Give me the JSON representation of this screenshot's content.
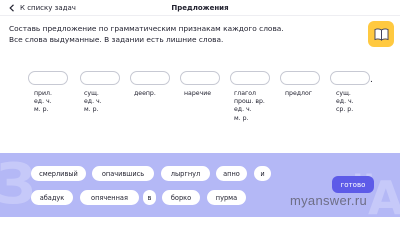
{
  "header": {
    "back_label": "К списку задач",
    "title": "Предложения"
  },
  "instructions": {
    "line1": "Составь предложение по грамматическим признакам каждого слова.",
    "line2": "Все слова выдуманные. В задании есть лишние слова."
  },
  "sentence": {
    "period": ".",
    "hints": [
      [
        "прил.",
        "ед. ч.",
        "м. р."
      ],
      [
        "сущ.",
        "ед. ч.",
        "м. р."
      ],
      [
        "деепр."
      ],
      [
        "наречие"
      ],
      [
        "глагол",
        "прош. вр.",
        "ед. ч.",
        "м. р."
      ],
      [
        "предлог"
      ],
      [
        "сущ.",
        "ед. ч.",
        "ср. р."
      ]
    ]
  },
  "word_bank": {
    "row1": [
      "смерливый",
      "опачившись",
      "лыргнул",
      "апно",
      "и"
    ],
    "row2": [
      "абадук",
      "опяченная",
      "в",
      "борко",
      "пурма"
    ],
    "done_label": "готово"
  },
  "watermark": "myanswer.ru",
  "colors": {
    "panel_bg": "#b4b8f6",
    "accent": "#5d5be8",
    "book_button": "#ffc940"
  },
  "icons": {
    "back": "chevron-left-icon",
    "book": "book-icon"
  }
}
